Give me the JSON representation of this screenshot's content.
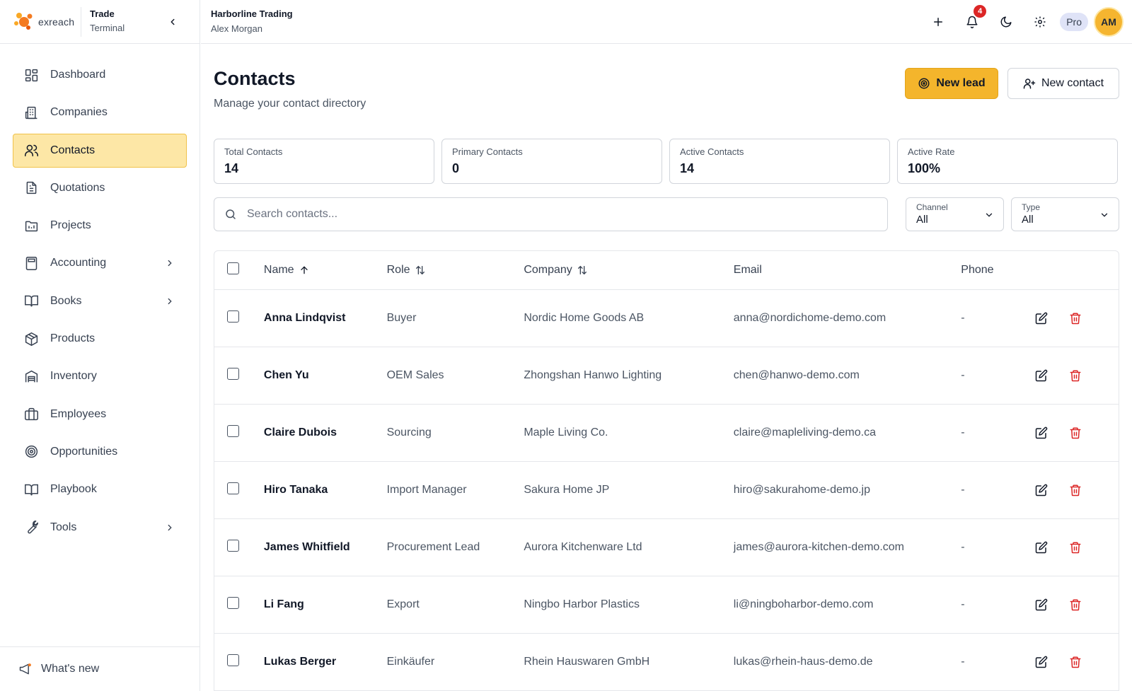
{
  "brand": {
    "logo_text": "exreach",
    "title_line1": "Trade",
    "title_line2": "Terminal"
  },
  "org": {
    "name": "Harborline Trading",
    "user": "Alex Morgan"
  },
  "topbar": {
    "notification_count": "4",
    "plan": "Pro",
    "avatar_initials": "AM"
  },
  "sidebar": {
    "items": [
      {
        "label": "Dashboard",
        "icon": "dashboard-icon"
      },
      {
        "label": "Companies",
        "icon": "building-icon"
      },
      {
        "label": "Contacts",
        "icon": "users-icon",
        "active": true
      },
      {
        "label": "Quotations",
        "icon": "document-icon"
      },
      {
        "label": "Projects",
        "icon": "folder-chart-icon"
      },
      {
        "label": "Accounting",
        "icon": "calculator-icon",
        "expandable": true
      },
      {
        "label": "Books",
        "icon": "book-open-icon",
        "expandable": true
      },
      {
        "label": "Products",
        "icon": "box-icon"
      },
      {
        "label": "Inventory",
        "icon": "warehouse-icon"
      },
      {
        "label": "Employees",
        "icon": "briefcase-icon"
      },
      {
        "label": "Opportunities",
        "icon": "target-icon"
      },
      {
        "label": "Playbook",
        "icon": "book-icon"
      },
      {
        "label": "Tools",
        "icon": "wrench-icon",
        "expandable": true
      }
    ],
    "whats_new": "What's new"
  },
  "page": {
    "title": "Contacts",
    "subtitle": "Manage your contact directory",
    "new_lead_label": "New lead",
    "new_contact_label": "New contact"
  },
  "stats": [
    {
      "label": "Total Contacts",
      "value": "14"
    },
    {
      "label": "Primary Contacts",
      "value": "0"
    },
    {
      "label": "Active Contacts",
      "value": "14"
    },
    {
      "label": "Active Rate",
      "value": "100%"
    }
  ],
  "search": {
    "placeholder": "Search contacts..."
  },
  "filters": {
    "channel": {
      "label": "Channel",
      "value": "All"
    },
    "type": {
      "label": "Type",
      "value": "All"
    }
  },
  "table": {
    "columns": {
      "name": "Name",
      "role": "Role",
      "company": "Company",
      "email": "Email",
      "phone": "Phone"
    },
    "rows": [
      {
        "name": "Anna Lindqvist",
        "role": "Buyer",
        "company": "Nordic Home Goods AB",
        "email": "anna@nordichome-demo.com",
        "phone": "-"
      },
      {
        "name": "Chen Yu",
        "role": "OEM Sales",
        "company": "Zhongshan Hanwo Lighting",
        "email": "chen@hanwo-demo.com",
        "phone": "-"
      },
      {
        "name": "Claire Dubois",
        "role": "Sourcing",
        "company": "Maple Living Co.",
        "email": "claire@mapleliving-demo.ca",
        "phone": "-"
      },
      {
        "name": "Hiro Tanaka",
        "role": "Import Manager",
        "company": "Sakura Home JP",
        "email": "hiro@sakurahome-demo.jp",
        "phone": "-"
      },
      {
        "name": "James Whitfield",
        "role": "Procurement Lead",
        "company": "Aurora Kitchenware Ltd",
        "email": "james@aurora-kitchen-demo.com",
        "phone": "-"
      },
      {
        "name": "Li Fang",
        "role": "Export",
        "company": "Ningbo Harbor Plastics",
        "email": "li@ningboharbor-demo.com",
        "phone": "-"
      },
      {
        "name": "Lukas Berger",
        "role": "Einkäufer",
        "company": "Rhein Hauswaren GmbH",
        "email": "lukas@rhein-haus-demo.de",
        "phone": "-"
      }
    ]
  },
  "colors": {
    "accent": "#f4b52c",
    "active_bg": "#fde7a6",
    "danger": "#dc2626",
    "border": "#e5e7eb"
  }
}
